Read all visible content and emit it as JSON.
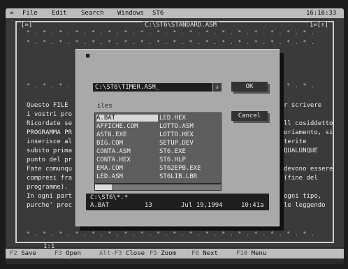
{
  "menubar": {
    "close": "=",
    "items": [
      "File",
      "Edit",
      "Search",
      "Windows",
      "ST6"
    ],
    "clock": "16:16:33"
  },
  "editor": {
    "filename": "C:\\ST6\\STANDARD.ASM",
    "corner_left": "[=]",
    "corner_right": "1=[↑]",
    "left_lines": [
      "Questo FILE",
      "i vostri pro",
      "Ricordate se",
      "PROGRAMMA PR",
      "inserisce al",
      "subito prima",
      "punto del pr",
      "Fate comunqu",
      "compresi fra",
      "programme).",
      "In ogni part",
      "purche' prec"
    ],
    "right_lines": [
      "r scrivere",
      "",
      "ll cosiddetto",
      "oriamento, si",
      "terite",
      "QUALUNQUE",
      "",
      "devono essere",
      "(fine del",
      "",
      "ogni tipo,",
      "le leggendo"
    ],
    "status_pos": "1:1"
  },
  "dialog": {
    "close": "■",
    "filename_value": "C:\\ST6\\TIMER.ASM_",
    "arrow": "↓",
    "ok_label": "OK",
    "cancel_label": "Cancel",
    "files_label": "iles",
    "files_col1": [
      "A.BAT",
      "AFFICHE.COM",
      "AST6.EXE",
      "BIG.COM",
      "CONTA.ASM",
      "CONTA.HEX",
      "EMA.COM",
      "LED.ASM"
    ],
    "files_col2": [
      "LED.HEX",
      "LOTTO.ASM",
      "LOTTO.HEX",
      "SETUP.DEV",
      "ST6.EXE",
      "ST6.HLP",
      "ST62EPB.EXE",
      "ST6LIB.LBR"
    ],
    "path_mask": "C:\\ST6\\*.*",
    "info_name": "A.BAT",
    "info_size": "13",
    "info_date": "Jul 19,1994",
    "info_time": "10:41a"
  },
  "fnbar": [
    {
      "key": "F2",
      "label": "Save"
    },
    {
      "key": "F3",
      "label": "Open"
    },
    {
      "key": "Alt-F3",
      "label": "Close"
    },
    {
      "key": "F5",
      "label": "Zoom"
    },
    {
      "key": "F6",
      "label": "Next"
    },
    {
      "key": "F10",
      "label": "Menu"
    }
  ]
}
